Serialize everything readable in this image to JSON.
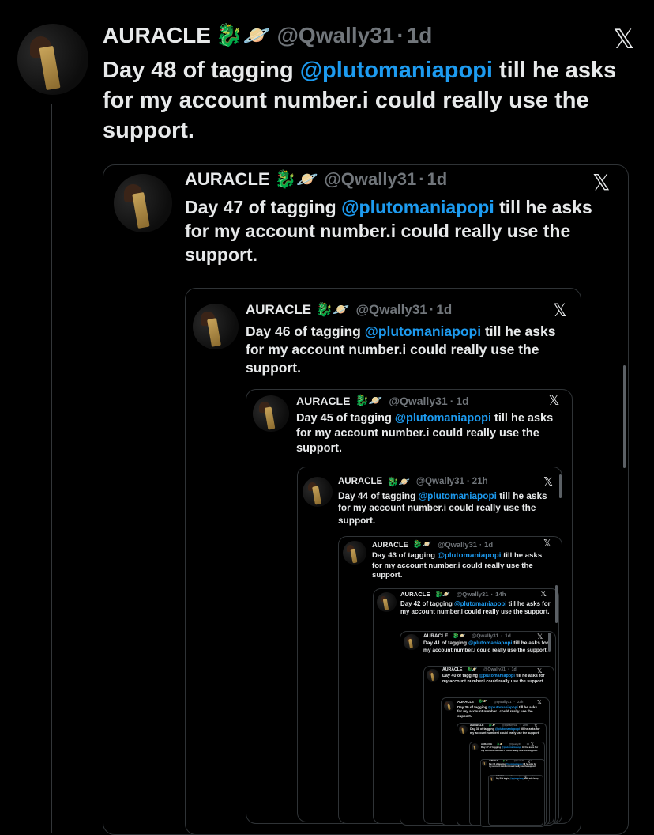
{
  "author": {
    "name": "AURACLE",
    "emoji": "🐉🪐",
    "handle": "@Qwally31",
    "dot": "·"
  },
  "body_parts": {
    "before_mention": "of tagging",
    "mention": "@plutomaniapopi",
    "after_mention": "till he asks for my account number.i could really use the support."
  },
  "close_glyph": "𝕏",
  "tweets": [
    {
      "day": "Day 48",
      "time": "1d"
    },
    {
      "day": "Day 47",
      "time": "1d"
    },
    {
      "day": "Day 46",
      "time": "1d"
    },
    {
      "day": "Day 45",
      "time": "1d"
    },
    {
      "day": "Day 44",
      "time": "21h"
    },
    {
      "day": "Day 43",
      "time": "1d"
    },
    {
      "day": "Day 42",
      "time": "14h"
    },
    {
      "day": "Day 41",
      "time": "1d"
    },
    {
      "day": "Day 40",
      "time": "1d"
    },
    {
      "day": "Day 39",
      "time": "23h"
    },
    {
      "day": "Day 38",
      "time": "20h"
    },
    {
      "day": "Day 37",
      "time": "1d"
    },
    {
      "day": "Day 36",
      "time": "1d"
    },
    {
      "day": "Day 35",
      "time": "1d"
    }
  ],
  "colors": {
    "background": "#000000",
    "text": "#e7e9ea",
    "muted": "#71767b",
    "mention": "#1d9bf0",
    "border": "#2f3336"
  }
}
